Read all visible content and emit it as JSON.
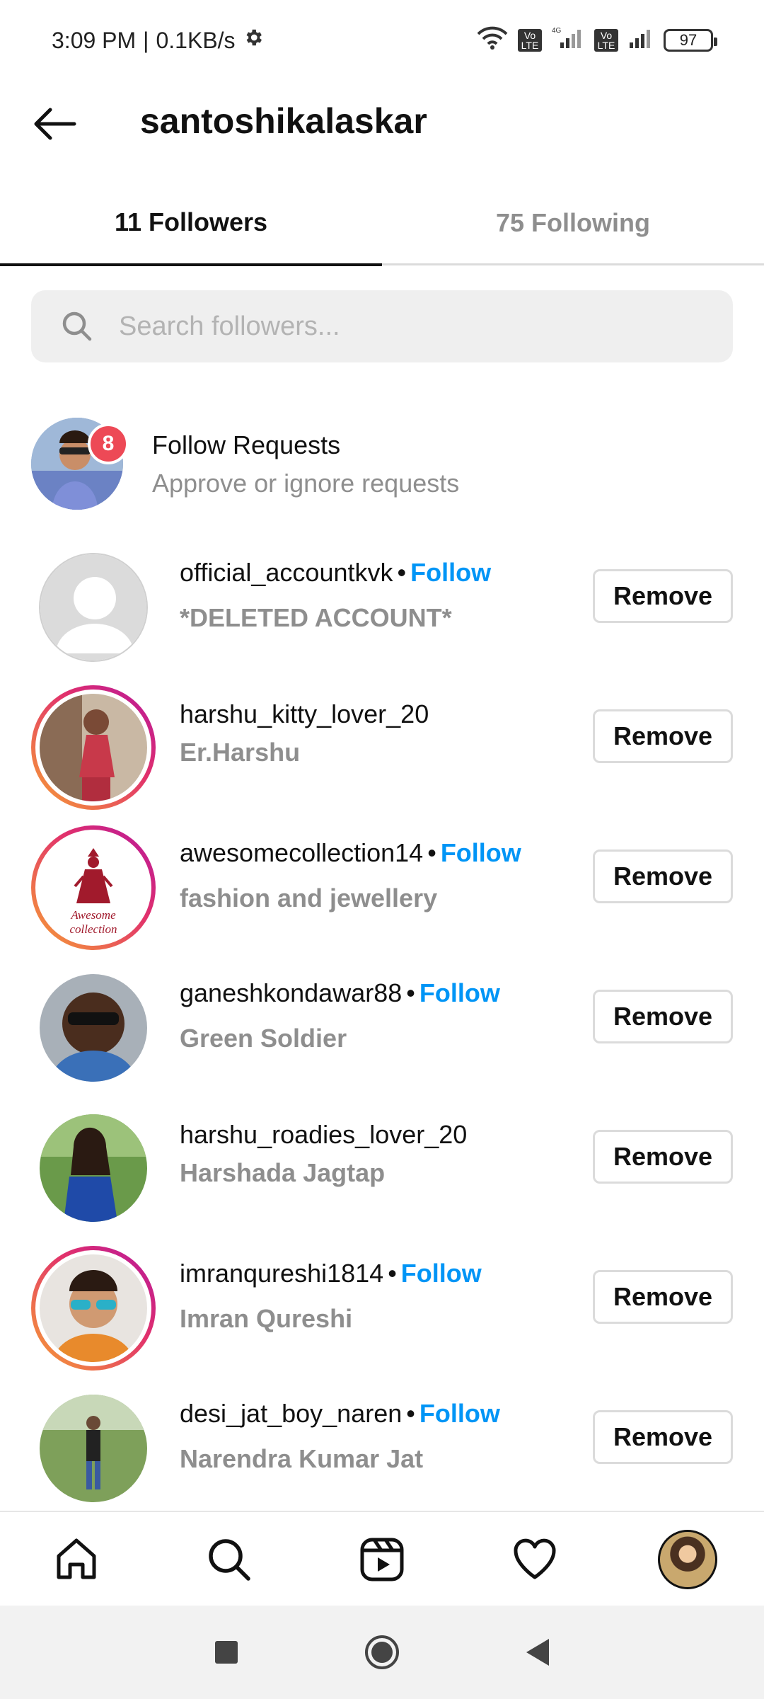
{
  "status_bar": {
    "time": "3:09 PM",
    "speed": "0.1KB/s",
    "network_type": "4G",
    "volte_label": "Vo LTE",
    "battery": "97"
  },
  "header": {
    "title": "santoshikalaskar"
  },
  "tabs": [
    {
      "label": "11 Followers",
      "active": true
    },
    {
      "label": "75 Following",
      "active": false
    }
  ],
  "search": {
    "placeholder": "Search followers..."
  },
  "follow_requests": {
    "badge": "8",
    "title": "Follow Requests",
    "subtitle": "Approve or ignore requests"
  },
  "followers": [
    {
      "handle": "official_accountkvk",
      "follow": "Follow",
      "name": "*DELETED ACCOUNT*",
      "remove": "Remove",
      "story": false
    },
    {
      "handle": "harshu_kitty_lover_20",
      "follow": "",
      "name": "Er.Harshu",
      "remove": "Remove",
      "story": true
    },
    {
      "handle": "awesomecollection14",
      "follow": "Follow",
      "name": "fashion and jewellery",
      "remove": "Remove",
      "story": true,
      "avatar_text": "Awesome collection"
    },
    {
      "handle": "ganeshkondawar88",
      "follow": "Follow",
      "name": "Green Soldier",
      "remove": "Remove",
      "story": false
    },
    {
      "handle": "harshu_roadies_lover_20",
      "follow": "",
      "name": "Harshada Jagtap",
      "remove": "Remove",
      "story": false
    },
    {
      "handle": "imranqureshi1814",
      "follow": "Follow",
      "name": "Imran Qureshi",
      "remove": "Remove",
      "story": true
    },
    {
      "handle": "desi_jat_boy_naren",
      "follow": "Follow",
      "name": "Narendra Kumar Jat",
      "remove": "Remove",
      "story": false
    }
  ],
  "bottom_nav": [
    "home-icon",
    "search-icon",
    "reels-icon",
    "heart-icon",
    "profile-avatar"
  ],
  "system_nav": [
    "recents-button",
    "home-button",
    "back-button"
  ],
  "colors": {
    "link_blue": "#0095f6",
    "badge_red": "#ed4956",
    "muted_gray": "#8e8e8e",
    "search_bg": "#efefef"
  }
}
